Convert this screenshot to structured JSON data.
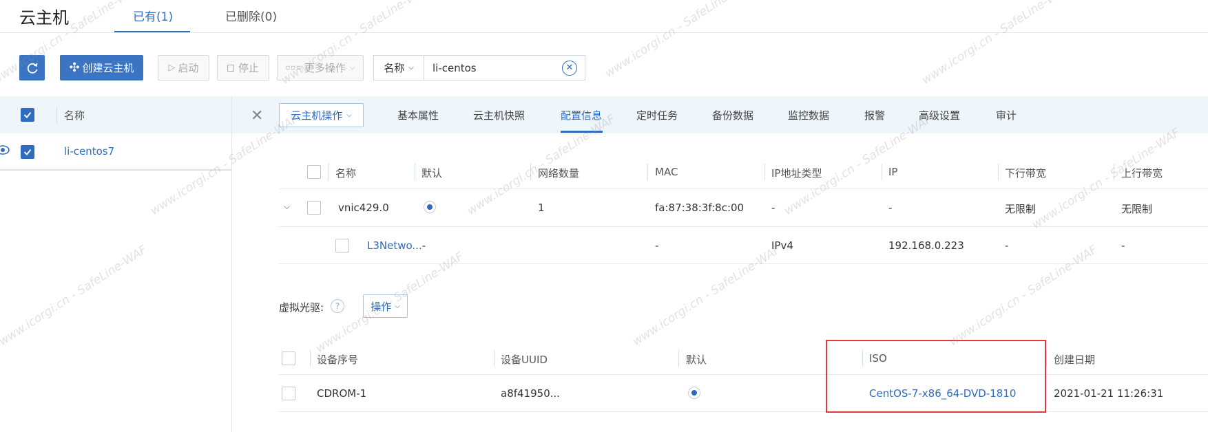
{
  "header": {
    "title": "云主机",
    "tabs": [
      {
        "label": "已有(1)",
        "active": true
      },
      {
        "label": "已删除(0)",
        "active": false
      }
    ]
  },
  "toolbar": {
    "refresh_icon": "refresh-icon",
    "create_label": "创建云主机",
    "start_label": "启动",
    "stop_label": "停止",
    "more_label": "更多操作",
    "search": {
      "field_label": "名称",
      "value": "li-centos"
    }
  },
  "vm_list": {
    "header_label": "名称",
    "items": [
      {
        "name": "li-centos7",
        "checked": true
      }
    ]
  },
  "detail": {
    "actions_label": "云主机操作",
    "tabs": [
      "基本属性",
      "云主机快照",
      "配置信息",
      "定时任务",
      "备份数据",
      "监控数据",
      "报警",
      "高级设置",
      "审计"
    ],
    "active_tab": "配置信息"
  },
  "nic_table": {
    "columns": [
      "名称",
      "默认",
      "网络数量",
      "MAC",
      "IP地址类型",
      "IP",
      "下行带宽",
      "上行带宽"
    ],
    "rows": [
      {
        "name": "vnic429.0",
        "default": true,
        "count": "1",
        "mac": "fa:87:38:3f:8c:00",
        "ip_type": "-",
        "ip": "-",
        "down": "无限制",
        "up": "无限制"
      },
      {
        "name": "L3Netwo...",
        "name_suffix": "-",
        "mac": "-",
        "ip_type": "IPv4",
        "ip": "192.168.0.223",
        "down": "-",
        "up": "-"
      }
    ]
  },
  "cdrom": {
    "section_label": "虚拟光驱:",
    "help_glyph": "?",
    "action_label": "操作",
    "columns": [
      "设备序号",
      "设备UUID",
      "默认",
      "ISO",
      "创建日期"
    ],
    "rows": [
      {
        "device": "CDROM-1",
        "uuid": "a8f41950...",
        "default": true,
        "iso": "CentOS-7-x86_64-DVD-1810",
        "created": "2021-01-21 11:26:31"
      }
    ]
  },
  "colors": {
    "accent": "#2d6cc0",
    "highlight": "#e0383b"
  },
  "watermark": "www.icorgi.cn - SafeLine-WAF"
}
